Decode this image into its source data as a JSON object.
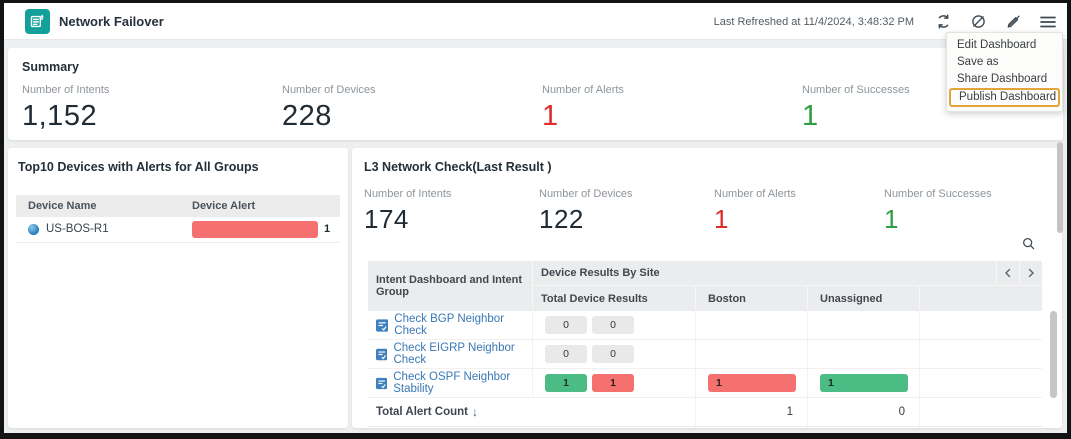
{
  "header": {
    "title": "Network Failover",
    "last_refreshed": "Last Refreshed at 11/4/2024, 3:48:32 PM",
    "icons": [
      "refresh-icon",
      "hide-widgets-icon",
      "annotation-off-icon",
      "menu-icon"
    ]
  },
  "menu": {
    "items": [
      {
        "label": "Edit Dashboard",
        "highlighted": false
      },
      {
        "label": "Save as",
        "highlighted": false
      },
      {
        "label": "Share Dashboard",
        "highlighted": false
      },
      {
        "label": "Publish Dashboard",
        "highlighted": true
      }
    ]
  },
  "summary": {
    "title": "Summary",
    "stats": [
      {
        "label": "Number of Intents",
        "value": "1,152",
        "color": "#212b33"
      },
      {
        "label": "Number of Devices",
        "value": "228",
        "color": "#212b33"
      },
      {
        "label": "Number of Alerts",
        "value": "1",
        "color": "#e02b2b"
      },
      {
        "label": "Number of Successes",
        "value": "1",
        "color": "#2e9e40"
      }
    ]
  },
  "top_devices": {
    "title": "Top10 Devices with Alerts for All Groups",
    "columns": [
      "Device Name",
      "Device Alert"
    ],
    "rows": [
      {
        "device": "US-BOS-R1",
        "alert_count": "1",
        "bar_color": "#f5716f"
      }
    ]
  },
  "l3": {
    "title": "L3 Network Check(Last Result )",
    "stats": [
      {
        "label": "Number of Intents",
        "value": "174",
        "color": "#212b33"
      },
      {
        "label": "Number of Devices",
        "value": "122",
        "color": "#212b33"
      },
      {
        "label": "Number of Alerts",
        "value": "1",
        "color": "#e02b2b"
      },
      {
        "label": "Number of Successes",
        "value": "1",
        "color": "#2e9e40"
      }
    ],
    "table": {
      "col1_header": "Intent Dashboard and Intent Group",
      "group_header": "Device Results By Site",
      "site_columns": [
        "Total Device Results",
        "Boston",
        "Unassigned"
      ],
      "rows": [
        {
          "name": "Check BGP Neighbor Check",
          "total": [
            "0",
            "0"
          ],
          "total_styles": [
            "gray",
            "gray"
          ],
          "boston": "",
          "unassigned": ""
        },
        {
          "name": "Check EIGRP Neighbor Check",
          "total": [
            "0",
            "0"
          ],
          "total_styles": [
            "gray",
            "gray"
          ],
          "boston": "",
          "unassigned": ""
        },
        {
          "name": "Check OSPF Neighbor Stability",
          "total": [
            "1",
            "1"
          ],
          "total_styles": [
            "green",
            "red"
          ],
          "boston": "1",
          "boston_style": "red",
          "unassigned": "1",
          "unassigned_style": "green"
        }
      ],
      "footer": {
        "label": "Total Alert Count",
        "sort_icon": "↓",
        "boston": "1",
        "unassigned": "0"
      }
    }
  },
  "colors": {
    "brand_teal": "#14a09a",
    "alert_red": "#e02b2b",
    "success_green": "#2e9e40",
    "bar_red": "#f5716f",
    "bar_green": "#4cbc85",
    "pill_gray": "#e9e9ea",
    "link_blue": "#3a78b5",
    "highlight_orange": "#e3a43b"
  }
}
